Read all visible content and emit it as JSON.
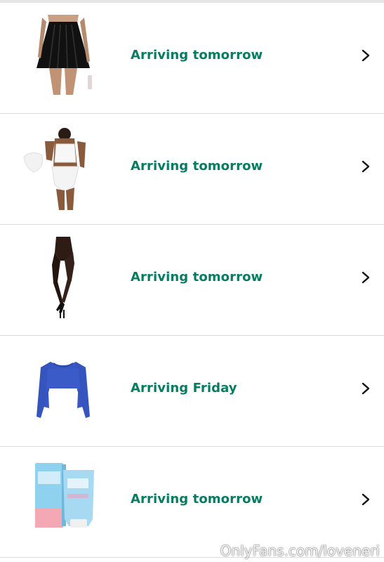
{
  "orders": [
    {
      "status": "Arriving tomorrow",
      "item_icon": "pleated-skirt-icon",
      "chevron": "chevron-right-icon"
    },
    {
      "status": "Arriving tomorrow",
      "item_icon": "lingerie-set-icon",
      "chevron": "chevron-right-icon"
    },
    {
      "status": "Arriving tomorrow",
      "item_icon": "tights-icon",
      "chevron": "chevron-right-icon"
    },
    {
      "status": "Arriving Friday",
      "item_icon": "long-sleeve-crop-top-icon",
      "chevron": "chevron-right-icon"
    },
    {
      "status": "Arriving tomorrow",
      "item_icon": "lubricant-gel-icon",
      "chevron": "chevron-right-icon"
    }
  ],
  "watermark": "OnlyFans.com/loveneri",
  "colors": {
    "status_text": "#067d62",
    "divider": "#dcdcdc",
    "background": "#ffffff"
  }
}
